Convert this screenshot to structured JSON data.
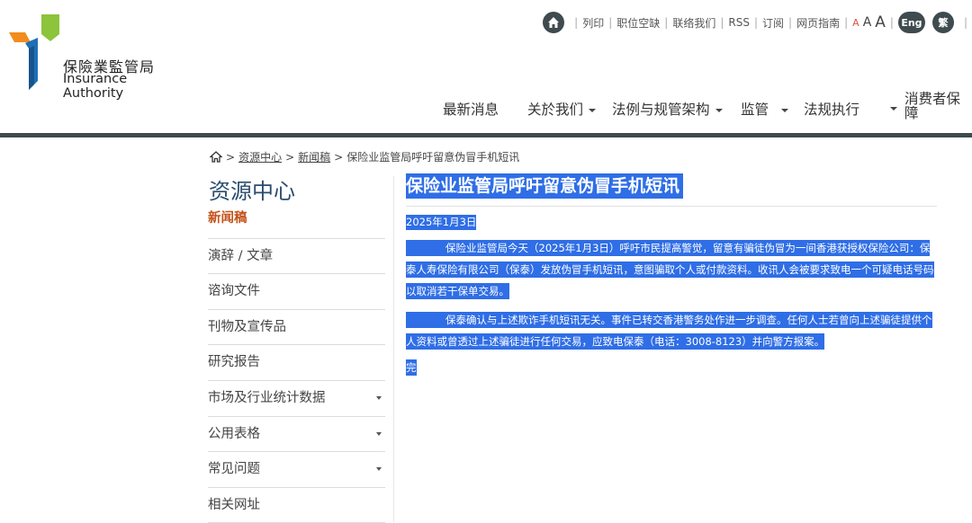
{
  "logo": {
    "cn": "保險業監管局",
    "en": "Insurance Authority"
  },
  "topbar": {
    "print": "列印",
    "vacancies": "职位空缺",
    "contact": "联络我们",
    "rss": "RSS",
    "subscribe": "订阅",
    "guide": "网页指南",
    "font_small": "A",
    "font_medium": "A",
    "font_large": "A",
    "eng": "Eng",
    "trad": "繁"
  },
  "nav": {
    "news": "最新消息",
    "about": "关於我们",
    "legislation": "法例与规管架构",
    "supervision": "监管",
    "enforcement": "法规执行",
    "consumer": "消费者保障"
  },
  "breadcrumb": {
    "resources": "资源中心",
    "press": "新闻稿",
    "current": "保险业监管局呼吁留意伪冒手机短讯"
  },
  "sidebar": {
    "title": "资源中心",
    "items": [
      {
        "label": "新闻稿"
      },
      {
        "label": "演辞 / 文章"
      },
      {
        "label": "谘询文件"
      },
      {
        "label": "刊物及宣传品"
      },
      {
        "label": "研究报告"
      },
      {
        "label": "市场及行业统计数据"
      },
      {
        "label": "公用表格"
      },
      {
        "label": "常见问题"
      },
      {
        "label": "相关网址"
      }
    ]
  },
  "article": {
    "title": "保险业监管局呼吁留意伪冒手机短讯",
    "date": "2025年1月3日",
    "para1": "保险业监管局今天（2025年1月3日）呼吁市民提高警觉，留意有骗徒伪冒为一间香港获授权保险公司：保泰人寿保险有限公司（保泰）发放伪冒手机短讯，意图骗取个人或付款资料。收讯人会被要求致电一个可疑电话号码以取消若干保单交易。",
    "para2": "保泰确认与上述欺诈手机短讯无关。事件已转交香港警务处作进一步调查。任何人士若曾向上述骗徒提供个人资料或曾透过上述骗徒进行任何交易，应致电保泰（电话：3008-8123）并向警方报案。",
    "end": "完"
  },
  "colors": {
    "selection": "#2f6ee6",
    "brand_dark": "#3d4a4f",
    "active": "#c4531b",
    "title_blue": "#2a4d6e"
  }
}
